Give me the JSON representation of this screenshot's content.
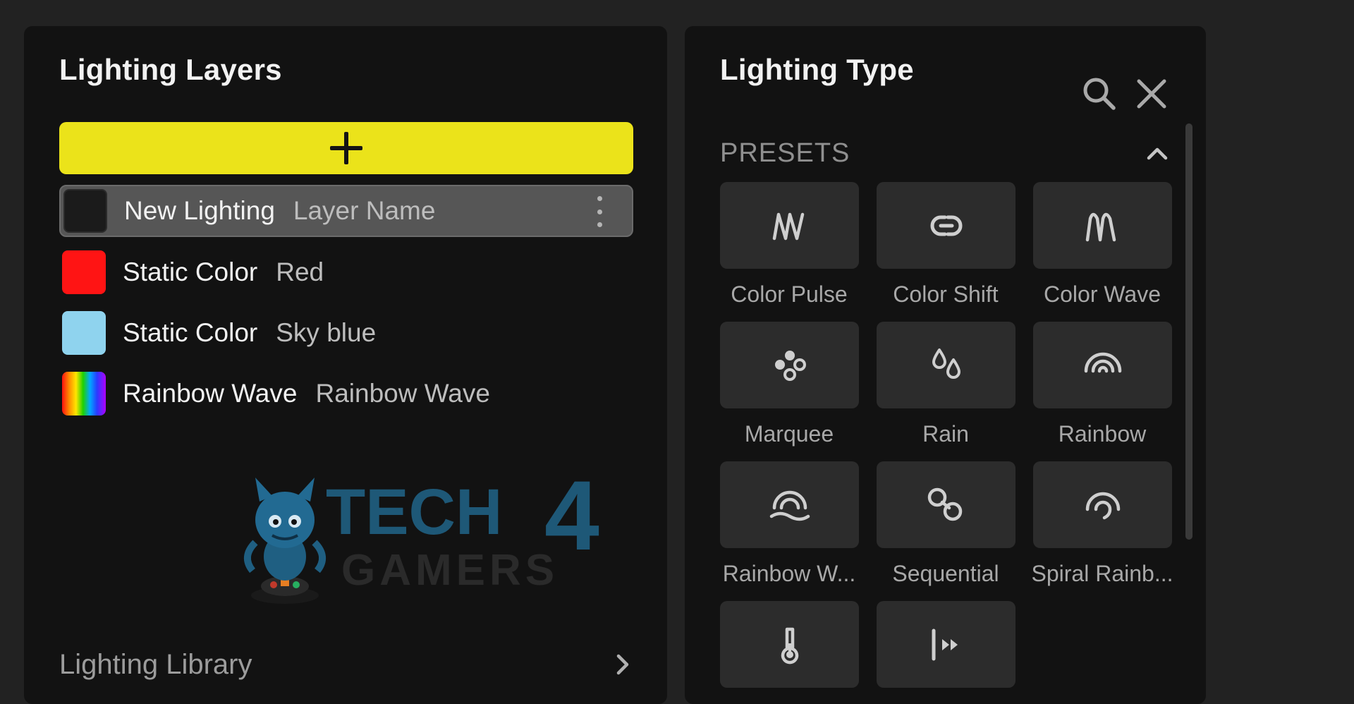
{
  "layers_panel": {
    "title": "Lighting Layers",
    "layers": [
      {
        "name": "New Lighting",
        "sub": "Layer Name",
        "swatch": "#1b1b1b",
        "selected": true
      },
      {
        "name": "Static Color",
        "sub": "Red",
        "swatch": "#ff1414"
      },
      {
        "name": "Static Color",
        "sub": "Sky blue",
        "swatch": "#8fd3ee"
      },
      {
        "name": "Rainbow Wave",
        "sub": "Rainbow Wave",
        "swatch": "rainbow"
      }
    ],
    "library_label": "Lighting Library",
    "watermark": {
      "top": "TECH",
      "number": "4",
      "bottom": "GAMERS"
    }
  },
  "type_panel": {
    "title": "Lighting Type",
    "section_label": "PRESETS",
    "presets": [
      {
        "label": "Color Pulse",
        "icon": "pulse-icon"
      },
      {
        "label": "Color Shift",
        "icon": "shift-icon"
      },
      {
        "label": "Color Wave",
        "icon": "wave-icon"
      },
      {
        "label": "Marquee",
        "icon": "marquee-icon"
      },
      {
        "label": "Rain",
        "icon": "rain-icon"
      },
      {
        "label": "Rainbow",
        "icon": "rainbow-icon"
      },
      {
        "label": "Rainbow W...",
        "icon": "rainbow-wave-icon"
      },
      {
        "label": "Sequential",
        "icon": "sequential-icon"
      },
      {
        "label": "Spiral Rainb...",
        "icon": "spiral-rainbow-icon"
      },
      {
        "label": "",
        "icon": "temperature-icon"
      },
      {
        "label": "",
        "icon": "visor-icon"
      }
    ]
  },
  "colors": {
    "accent": "#ebe31a",
    "panel": "#121212",
    "background": "#222222",
    "tile": "#2c2c2c"
  }
}
